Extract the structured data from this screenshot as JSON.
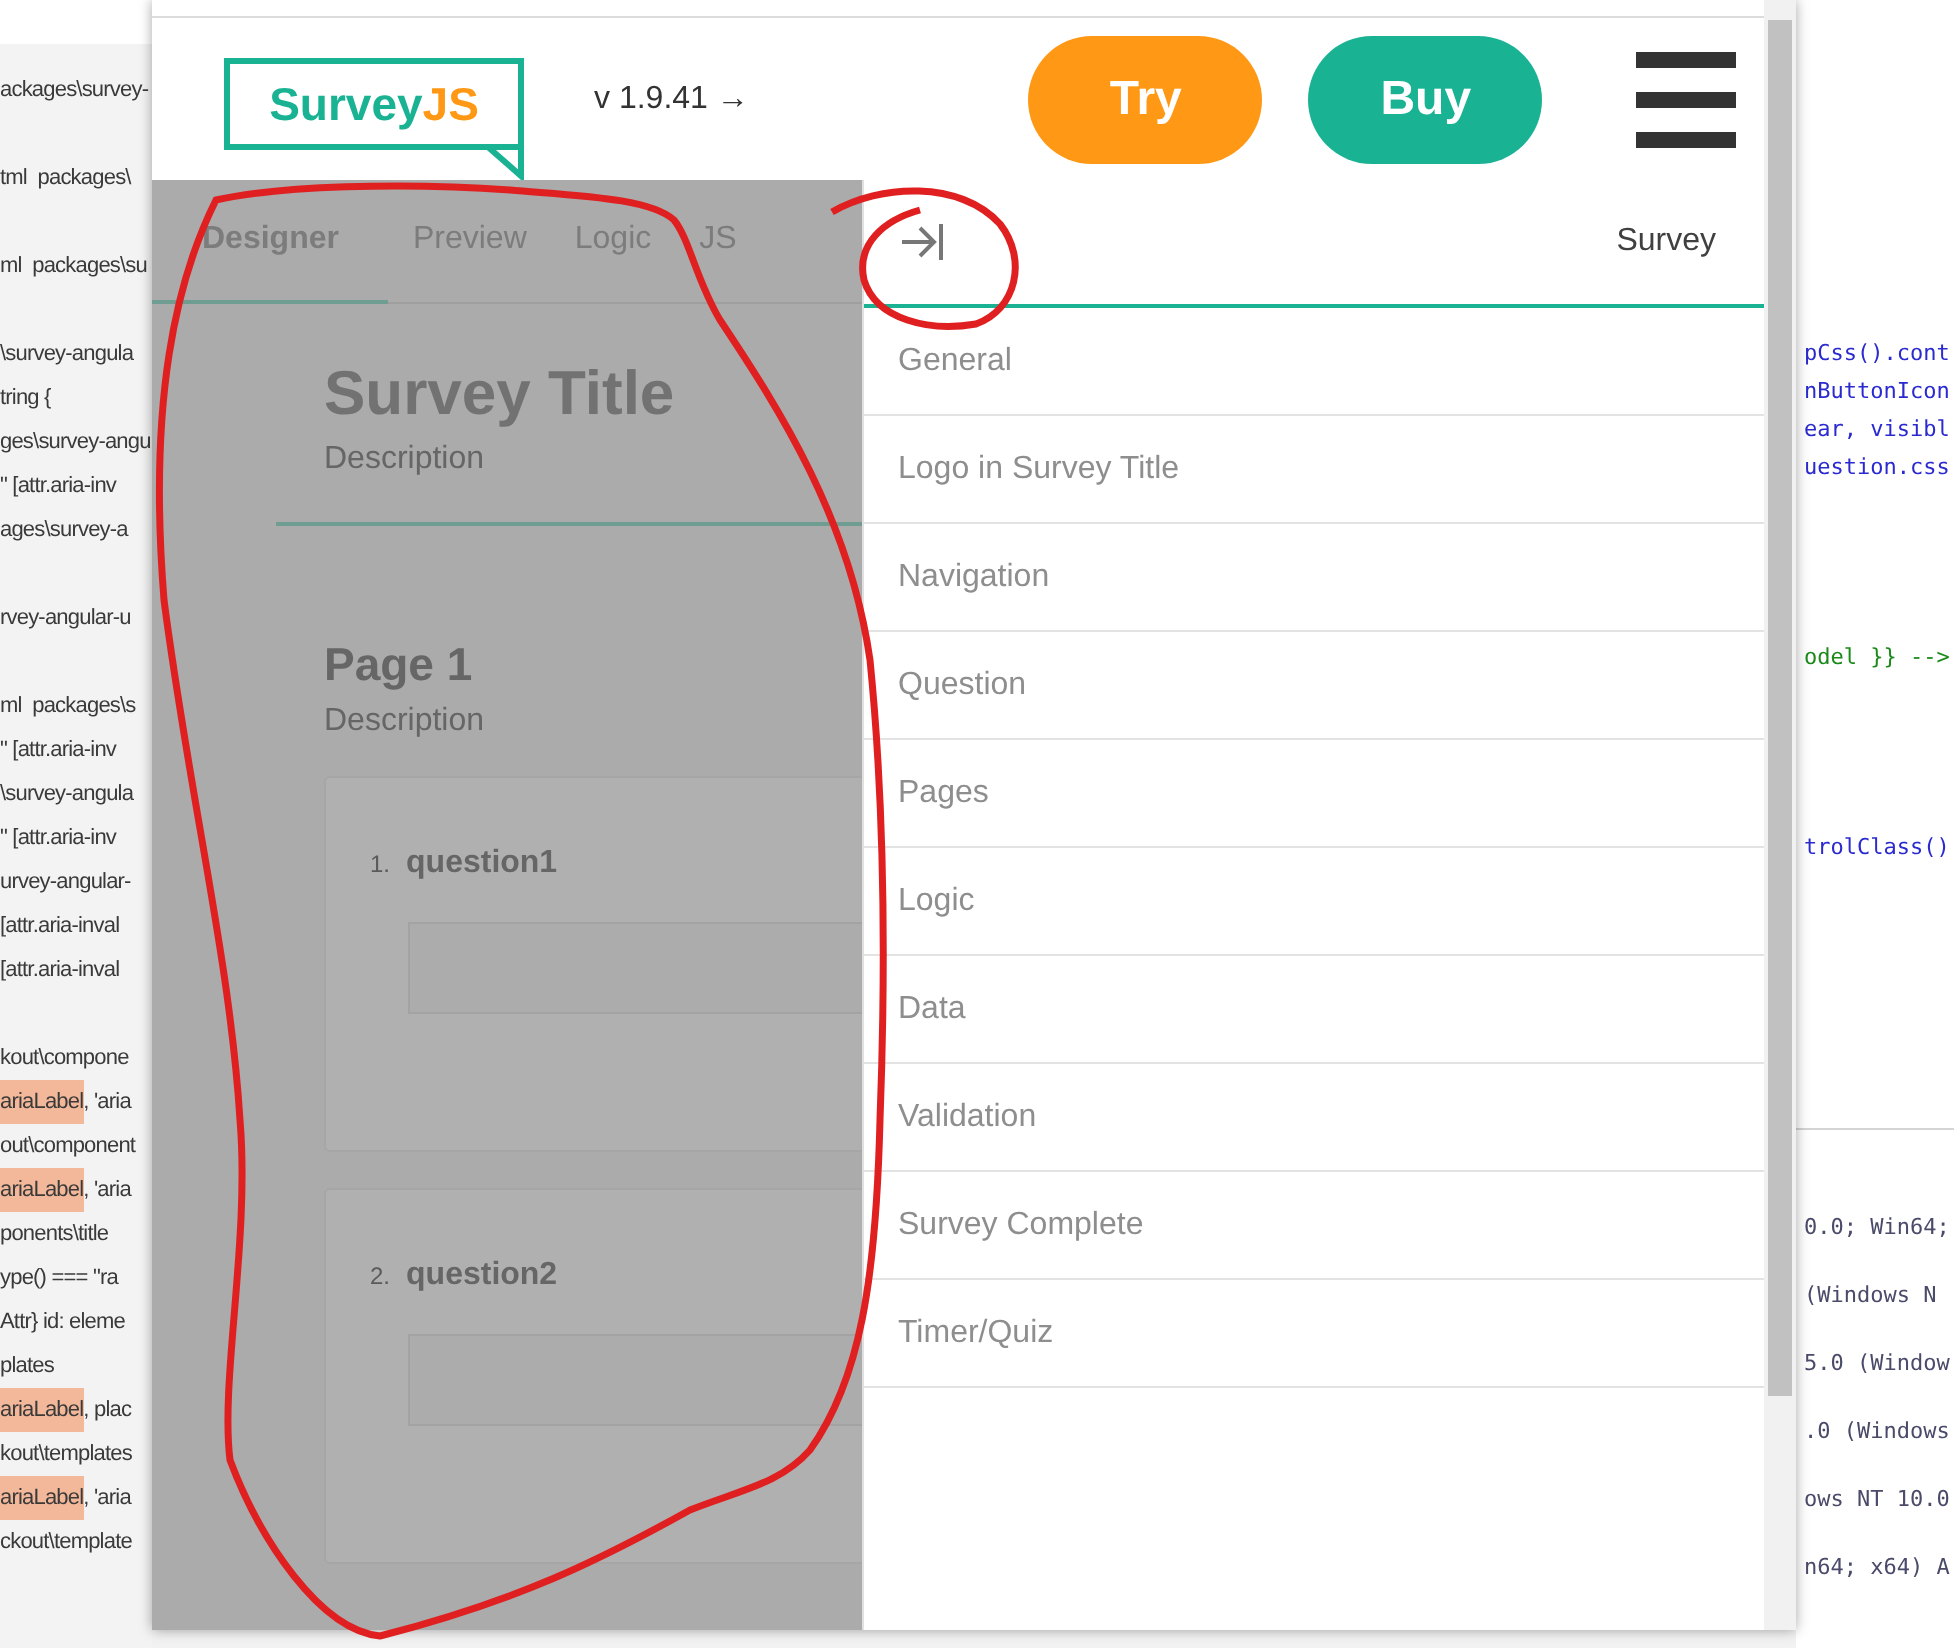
{
  "background_editor": {
    "left_lines": [
      {
        "kind": "plain",
        "text": "ackages\\survey-"
      },
      {
        "kind": "blank"
      },
      {
        "kind": "plain",
        "text": "tml  packages\\"
      },
      {
        "kind": "blank"
      },
      {
        "kind": "plain",
        "text": "ml  packages\\su"
      },
      {
        "kind": "blank"
      },
      {
        "kind": "plain",
        "text": "\\survey-angula"
      },
      {
        "kind": "plain",
        "text": "tring {"
      },
      {
        "kind": "plain",
        "text": "ges\\survey-angu"
      },
      {
        "kind": "plain",
        "text": "\" [attr.aria-inv"
      },
      {
        "kind": "plain",
        "text": "ages\\survey-a"
      },
      {
        "kind": "blank"
      },
      {
        "kind": "plain",
        "text": "rvey-angular-u"
      },
      {
        "kind": "blank"
      },
      {
        "kind": "plain",
        "text": "ml  packages\\s"
      },
      {
        "kind": "plain",
        "text": "\" [attr.aria-inv"
      },
      {
        "kind": "plain",
        "text": "\\survey-angula"
      },
      {
        "kind": "plain",
        "text": "\" [attr.aria-inv"
      },
      {
        "kind": "plain",
        "text": "urvey-angular-"
      },
      {
        "kind": "plain",
        "text": "[attr.aria-inval"
      },
      {
        "kind": "plain",
        "text": "[attr.aria-inval"
      },
      {
        "kind": "blank"
      },
      {
        "kind": "plain",
        "text": "kout\\compone"
      },
      {
        "kind": "highlight",
        "highlight": "ariaLabel",
        "rest": ", 'aria"
      },
      {
        "kind": "plain",
        "text": "out\\component"
      },
      {
        "kind": "highlight",
        "highlight": "ariaLabel",
        "rest": ", 'aria"
      },
      {
        "kind": "plain",
        "text": "ponents\\title"
      },
      {
        "kind": "plain",
        "text": "ype() === \"ra"
      },
      {
        "kind": "plain",
        "text": "Attr} id: eleme"
      },
      {
        "kind": "plain",
        "text": "plates"
      },
      {
        "kind": "highlight",
        "highlight": "ariaLabel",
        "rest": ", plac"
      },
      {
        "kind": "plain",
        "text": "kout\\templates"
      },
      {
        "kind": "highlight",
        "highlight": "ariaLabel",
        "rest": ", 'aria"
      },
      {
        "kind": "plain",
        "text": "ckout\\template"
      }
    ],
    "right_top_lines": [
      {
        "kind": "code",
        "text": "pCss().cont",
        "color": "#2a2ad0"
      },
      {
        "kind": "code",
        "text": "nButtonIcon",
        "color": "#2a2ad0"
      },
      {
        "kind": "code",
        "text": "ear, visibl",
        "color": "#2a2ad0"
      },
      {
        "kind": "code",
        "text": "uestion.css",
        "color": "#2a2ad0"
      },
      {
        "kind": "blank"
      },
      {
        "kind": "blank"
      },
      {
        "kind": "blank"
      },
      {
        "kind": "blank"
      },
      {
        "kind": "code",
        "text": "odel }} -->",
        "color": "#1a8a1a"
      },
      {
        "kind": "blank"
      },
      {
        "kind": "blank"
      },
      {
        "kind": "blank"
      },
      {
        "kind": "blank"
      },
      {
        "kind": "code",
        "text": "trolClass()",
        "color": "#2a2ad0"
      }
    ],
    "right_bottom_lines": [
      "0.0; Win64;",
      "(Windows N",
      "5.0 (Window",
      ".0 (Windows",
      "ows NT 10.0",
      "n64; x64) A"
    ]
  },
  "header": {
    "logo": {
      "main": "Survey",
      "accent": "JS"
    },
    "version_link": "v 1.9.41 →",
    "buttons": [
      {
        "label": "Try",
        "color": "#ff9814"
      },
      {
        "label": "Buy",
        "color": "#19b394"
      }
    ]
  },
  "designer": {
    "tabs": [
      {
        "label": "Designer",
        "selected": true
      },
      {
        "label": "Preview",
        "selected": false
      },
      {
        "label": "Logic",
        "selected": false
      },
      {
        "label": "JS",
        "selected": false
      }
    ],
    "survey_title": "Survey Title",
    "survey_description": "Description",
    "page_title": "Page 1",
    "page_description": "Description",
    "questions": [
      {
        "number": "1.",
        "title": "question1"
      },
      {
        "number": "2.",
        "title": "question2"
      }
    ]
  },
  "property_grid": {
    "title": "Survey",
    "categories": [
      "General",
      "Logo in Survey Title",
      "Navigation",
      "Question",
      "Pages",
      "Logic",
      "Data",
      "Validation",
      "Survey Complete",
      "Timer/Quiz"
    ]
  }
}
